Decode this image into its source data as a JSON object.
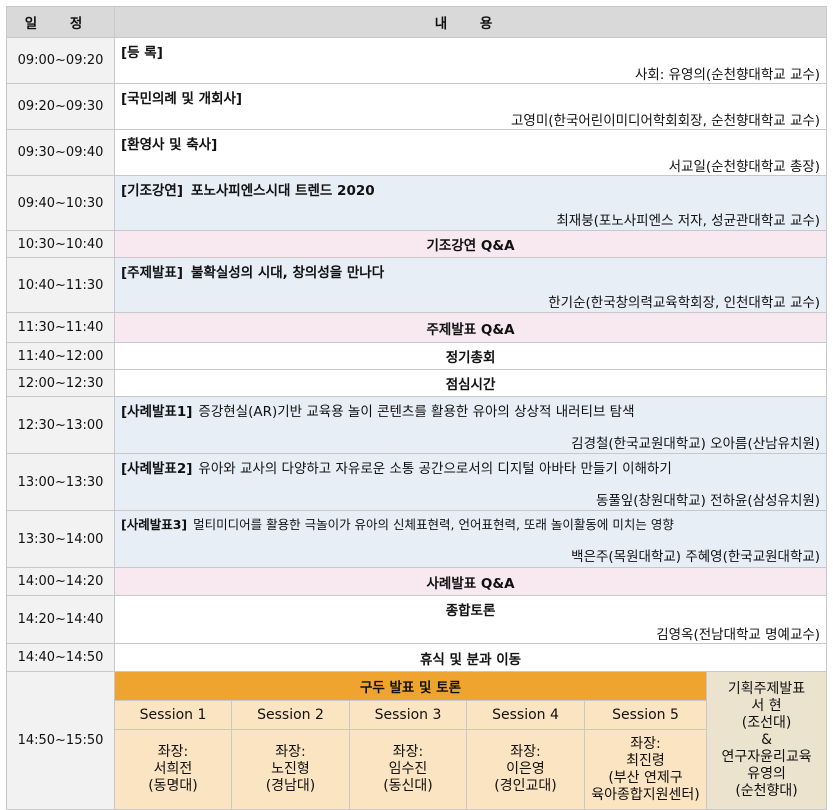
{
  "header": {
    "time": "일 정",
    "content": "내 용"
  },
  "rows": [
    {
      "time": "09:00~09:20",
      "label": "[등 록]",
      "speaker": "사회: 유영의(순천향대학교 교수)"
    },
    {
      "time": "09:20~09:30",
      "label": "[국민의례 및 개회사]",
      "speaker": "고영미(한국어린이미디어학회회장, 순천향대학교 교수)"
    },
    {
      "time": "09:30~09:40",
      "label": "[환영사 및 축사]",
      "speaker": "서교일(순천향대학교 총장)"
    },
    {
      "time": "09:40~10:30",
      "label": "[기조강연]",
      "title": "포노사피엔스시대 트렌드 2020",
      "speaker": "최재붕(포노사피엔스 저자, 성균관대학교 교수)"
    },
    {
      "time": "10:30~10:40",
      "center": "기조강연 Q&A"
    },
    {
      "time": "10:40~11:30",
      "label": "[주제발표]",
      "title": "불확실성의 시대, 창의성을 만나다",
      "speaker": "한기순(한국창의력교육학회장, 인천대학교 교수)"
    },
    {
      "time": "11:30~11:40",
      "center": "주제발표 Q&A"
    },
    {
      "time": "11:40~12:00",
      "center": "정기총회"
    },
    {
      "time": "12:00~12:30",
      "center": "점심시간"
    },
    {
      "time": "12:30~13:00",
      "label": "[사례발표1]",
      "desc": "증강현실(AR)기반 교육용 놀이 콘텐츠를 활용한 유아의 상상적 내러티브 탐색",
      "speaker": "김경철(한국교원대학교) 오아름(산남유치원)"
    },
    {
      "time": "13:00~13:30",
      "label": "[사례발표2]",
      "desc": "유아와 교사의 다양하고 자유로운 소통 공간으로서의 디지털 아바타 만들기 이해하기",
      "speaker": "동풀잎(창원대학교) 전하윤(삼성유치원)"
    },
    {
      "time": "13:30~14:00",
      "label": "[사례발표3]",
      "desc": "멀티미디어를 활용한 극놀이가 유아의 신체표현력, 언어표현력, 또래 놀이활동에 미치는 영향",
      "speaker": "백은주(목원대학교) 주혜영(한국교원대학교)"
    },
    {
      "time": "14:00~14:20",
      "center": "사례발표 Q&A"
    },
    {
      "time": "14:20~14:40",
      "center": "종합토론",
      "speaker": "김영옥(전남대학교 명예교수)"
    },
    {
      "time": "14:40~14:50",
      "center": "휴식 및 분과 이동"
    }
  ],
  "sessions": {
    "time": "14:50~15:50",
    "title": "구두 발표 및 토론",
    "items": [
      {
        "name": "Session 1",
        "chair_label": "좌장:",
        "chair": "서희전",
        "org": "(동명대)"
      },
      {
        "name": "Session 2",
        "chair_label": "좌장:",
        "chair": "노진형",
        "org": "(경남대)"
      },
      {
        "name": "Session 3",
        "chair_label": "좌장:",
        "chair": "임수진",
        "org": "(동신대)"
      },
      {
        "name": "Session 4",
        "chair_label": "좌장:",
        "chair": "이은영",
        "org": "(경인교대)"
      },
      {
        "name": "Session 5",
        "chair_label": "좌장:",
        "chair": "최진령",
        "org": "(부산 연제구",
        "org2": "육아종합지원센터)"
      }
    ],
    "special": {
      "line1": "기획주제발표",
      "line2": "서 현",
      "line3": "(조선대)",
      "line4": "&",
      "line5": "연구자윤리교육",
      "line6": "유영의",
      "line7": "(순천향대)"
    }
  }
}
